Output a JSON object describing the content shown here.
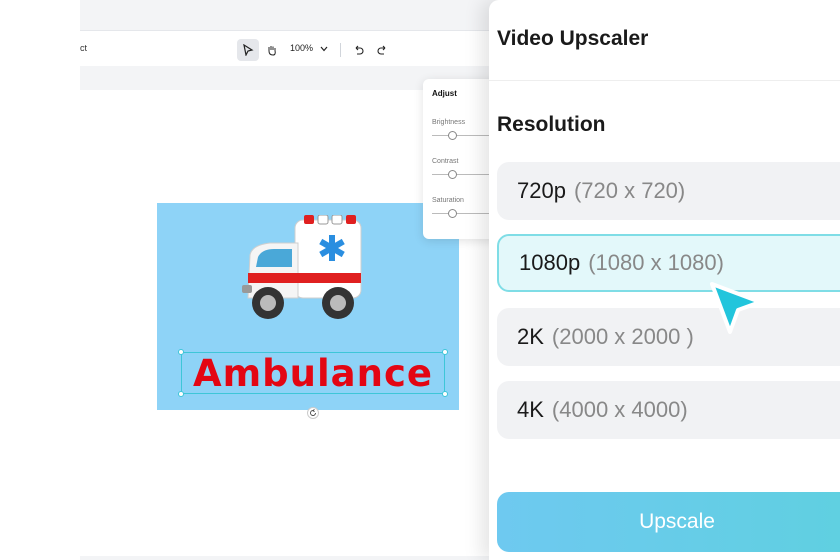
{
  "toolbar": {
    "breadcrumb": "ct",
    "zoom": "100%"
  },
  "canvas": {
    "text": "Ambulance"
  },
  "adjust": {
    "title": "Adjust",
    "sliders": [
      {
        "label": "Brightness"
      },
      {
        "label": "Contrast"
      },
      {
        "label": "Saturation"
      }
    ]
  },
  "panel": {
    "title": "Video Upscaler",
    "section": "Resolution",
    "options": [
      {
        "label": "720p",
        "detail": "(720 x 720)",
        "selected": false
      },
      {
        "label": "1080p",
        "detail": "(1080 x 1080)",
        "selected": true
      },
      {
        "label": "2K",
        "detail": "(2000 x 2000 )",
        "selected": false
      },
      {
        "label": "4K",
        "detail": "(4000 x 4000)",
        "selected": false
      }
    ],
    "button": "Upscale"
  },
  "colors": {
    "accent": "#5fd0e0",
    "text_red": "#e30613",
    "design_bg": "#8ed3f7"
  },
  "icons": [
    "pointer-icon",
    "hand-icon",
    "chevron-down-icon",
    "undo-icon",
    "redo-icon",
    "rotate-icon",
    "ambulance-icon",
    "cursor-icon"
  ]
}
